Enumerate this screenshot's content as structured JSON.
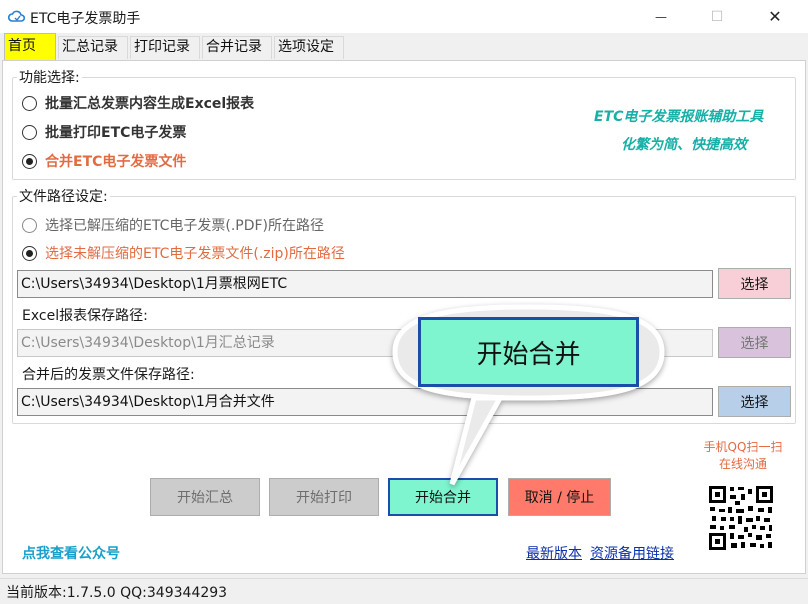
{
  "window": {
    "title": "ETC电子发票助手",
    "minimize_glyph": "—",
    "maximize_glyph": "☐",
    "close_glyph": "✕"
  },
  "tabs": [
    {
      "label": "首页",
      "active": true
    },
    {
      "label": "汇总记录",
      "active": false
    },
    {
      "label": "打印记录",
      "active": false
    },
    {
      "label": "合并记录",
      "active": false
    },
    {
      "label": "选项设定",
      "active": false
    }
  ],
  "function_group": {
    "legend": "功能选择:",
    "options": [
      {
        "label": "批量汇总发票内容生成Excel报表",
        "checked": false
      },
      {
        "label": "批量打印ETC电子发票",
        "checked": false
      },
      {
        "label": "合并ETC电子发票文件",
        "checked": true
      }
    ],
    "promo_line1": "ETC电子发票报账辅助工具",
    "promo_line2": "化繁为简、快捷高效"
  },
  "path_group": {
    "legend": "文件路径设定:",
    "options": [
      {
        "label": "选择已解压缩的ETC电子发票(.PDF)所在路径",
        "checked": false
      },
      {
        "label": "选择未解压缩的ETC电子发票文件(.zip)所在路径",
        "checked": true
      }
    ],
    "source_path": "C:\\Users\\34934\\Desktop\\1月票根网ETC",
    "source_button": "选择",
    "excel_label": "Excel报表保存路径:",
    "excel_path": "C:\\Users\\34934\\Desktop\\1月汇总记录",
    "excel_button": "选择",
    "merge_label": "合并后的发票文件保存路径:",
    "merge_path": "C:\\Users\\34934\\Desktop\\1月合并文件",
    "merge_button": "选择"
  },
  "actions": {
    "summarize": "开始汇总",
    "print": "开始打印",
    "merge": "开始合并",
    "cancel": "取消 / 停止"
  },
  "callout": {
    "label": "开始合并"
  },
  "footer": {
    "wechat_link": "点我查看公众号",
    "latest_version": "最新版本",
    "backup_link": "资源备用链接",
    "qq_scan_line1": "手机QQ扫一扫",
    "qq_scan_line2": "在线沟通"
  },
  "status": {
    "text": "当前版本:1.7.5.0  QQ:349344293"
  },
  "colors": {
    "active_tab": "#ffff00",
    "selected_option": "#e26b42",
    "promo": "#17b0a7",
    "merge_button": "#7ef5cf",
    "cancel_button": "#ff7a6a",
    "source_button": "#f8cfd6",
    "excel_button": "#d9c2dc",
    "merge_path_button": "#b7cfe8",
    "callout_border": "#1b4ea8"
  }
}
